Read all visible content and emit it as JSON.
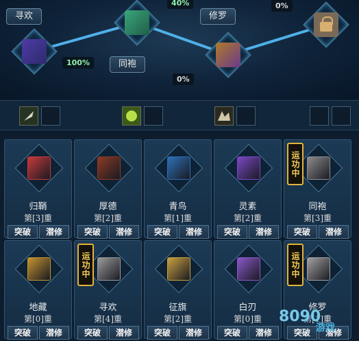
{
  "path": {
    "nodes": [
      {
        "icon": "skill-scroll-icon",
        "label": "寻欢",
        "percent": "100%"
      },
      {
        "icon": "skill-scroll-icon",
        "label": "同袍",
        "percent": "40%"
      },
      {
        "icon": "skill-book-icon",
        "label": "修罗",
        "percent": "0%"
      },
      {
        "icon": "padlock-icon",
        "label": "",
        "percent": "0%"
      }
    ],
    "link_percent": "0%"
  },
  "slots": {
    "items": [
      {
        "icon": "throwing-knife-icon"
      },
      {
        "icon": "empty-slot-icon"
      },
      {
        "icon": "green-aura-icon"
      },
      {
        "icon": "empty-slot-icon"
      },
      {
        "icon": "dark-beast-icon"
      },
      {
        "icon": "empty-slot-icon"
      },
      {
        "icon": "empty-slot-icon"
      },
      {
        "icon": "empty-slot-icon"
      }
    ]
  },
  "skills": {
    "break_label": "突破",
    "train_label": "潜修",
    "running_label": "运功中",
    "cards": [
      {
        "name": "归鞘",
        "level": "第[3]重",
        "running": false,
        "icon": "red-book-icon",
        "color": "#c43a3a"
      },
      {
        "name": "厚德",
        "level": "第[2]重",
        "running": false,
        "icon": "brown-book-icon",
        "color": "#8a3a24"
      },
      {
        "name": "青鸟",
        "level": "第[1]重",
        "running": false,
        "icon": "blue-book-icon",
        "color": "#2d6fb5"
      },
      {
        "name": "灵素",
        "level": "第[2]重",
        "running": false,
        "icon": "purple-book-icon",
        "color": "#7a48c4"
      },
      {
        "name": "同袍",
        "level": "第[3]重",
        "running": true,
        "icon": "grey-scroll-icon",
        "color": "#8c8c8c"
      },
      {
        "name": "地藏",
        "level": "第[0]重",
        "running": false,
        "icon": "gold-scroll-icon",
        "color": "#c4932f"
      },
      {
        "name": "寻欢",
        "level": "第[4]重",
        "running": true,
        "icon": "grey-scroll-icon",
        "color": "#9a9a9a"
      },
      {
        "name": "征旗",
        "level": "第[2]重",
        "running": false,
        "icon": "gold-scroll-icon",
        "color": "#c8a040"
      },
      {
        "name": "白刃",
        "level": "第[0]重",
        "running": false,
        "icon": "purple-scroll-icon",
        "color": "#8a58c8"
      },
      {
        "name": "修罗",
        "level": "第[1]重",
        "running": true,
        "icon": "grey-book-icon",
        "color": "#a0a0a0"
      }
    ]
  },
  "watermark": {
    "number": "8090",
    "text": "游戏"
  },
  "colors": {
    "accent_green": "#8ff0a8",
    "path_line": "#4fb0e8",
    "badge_gold": "#e3b43a"
  }
}
